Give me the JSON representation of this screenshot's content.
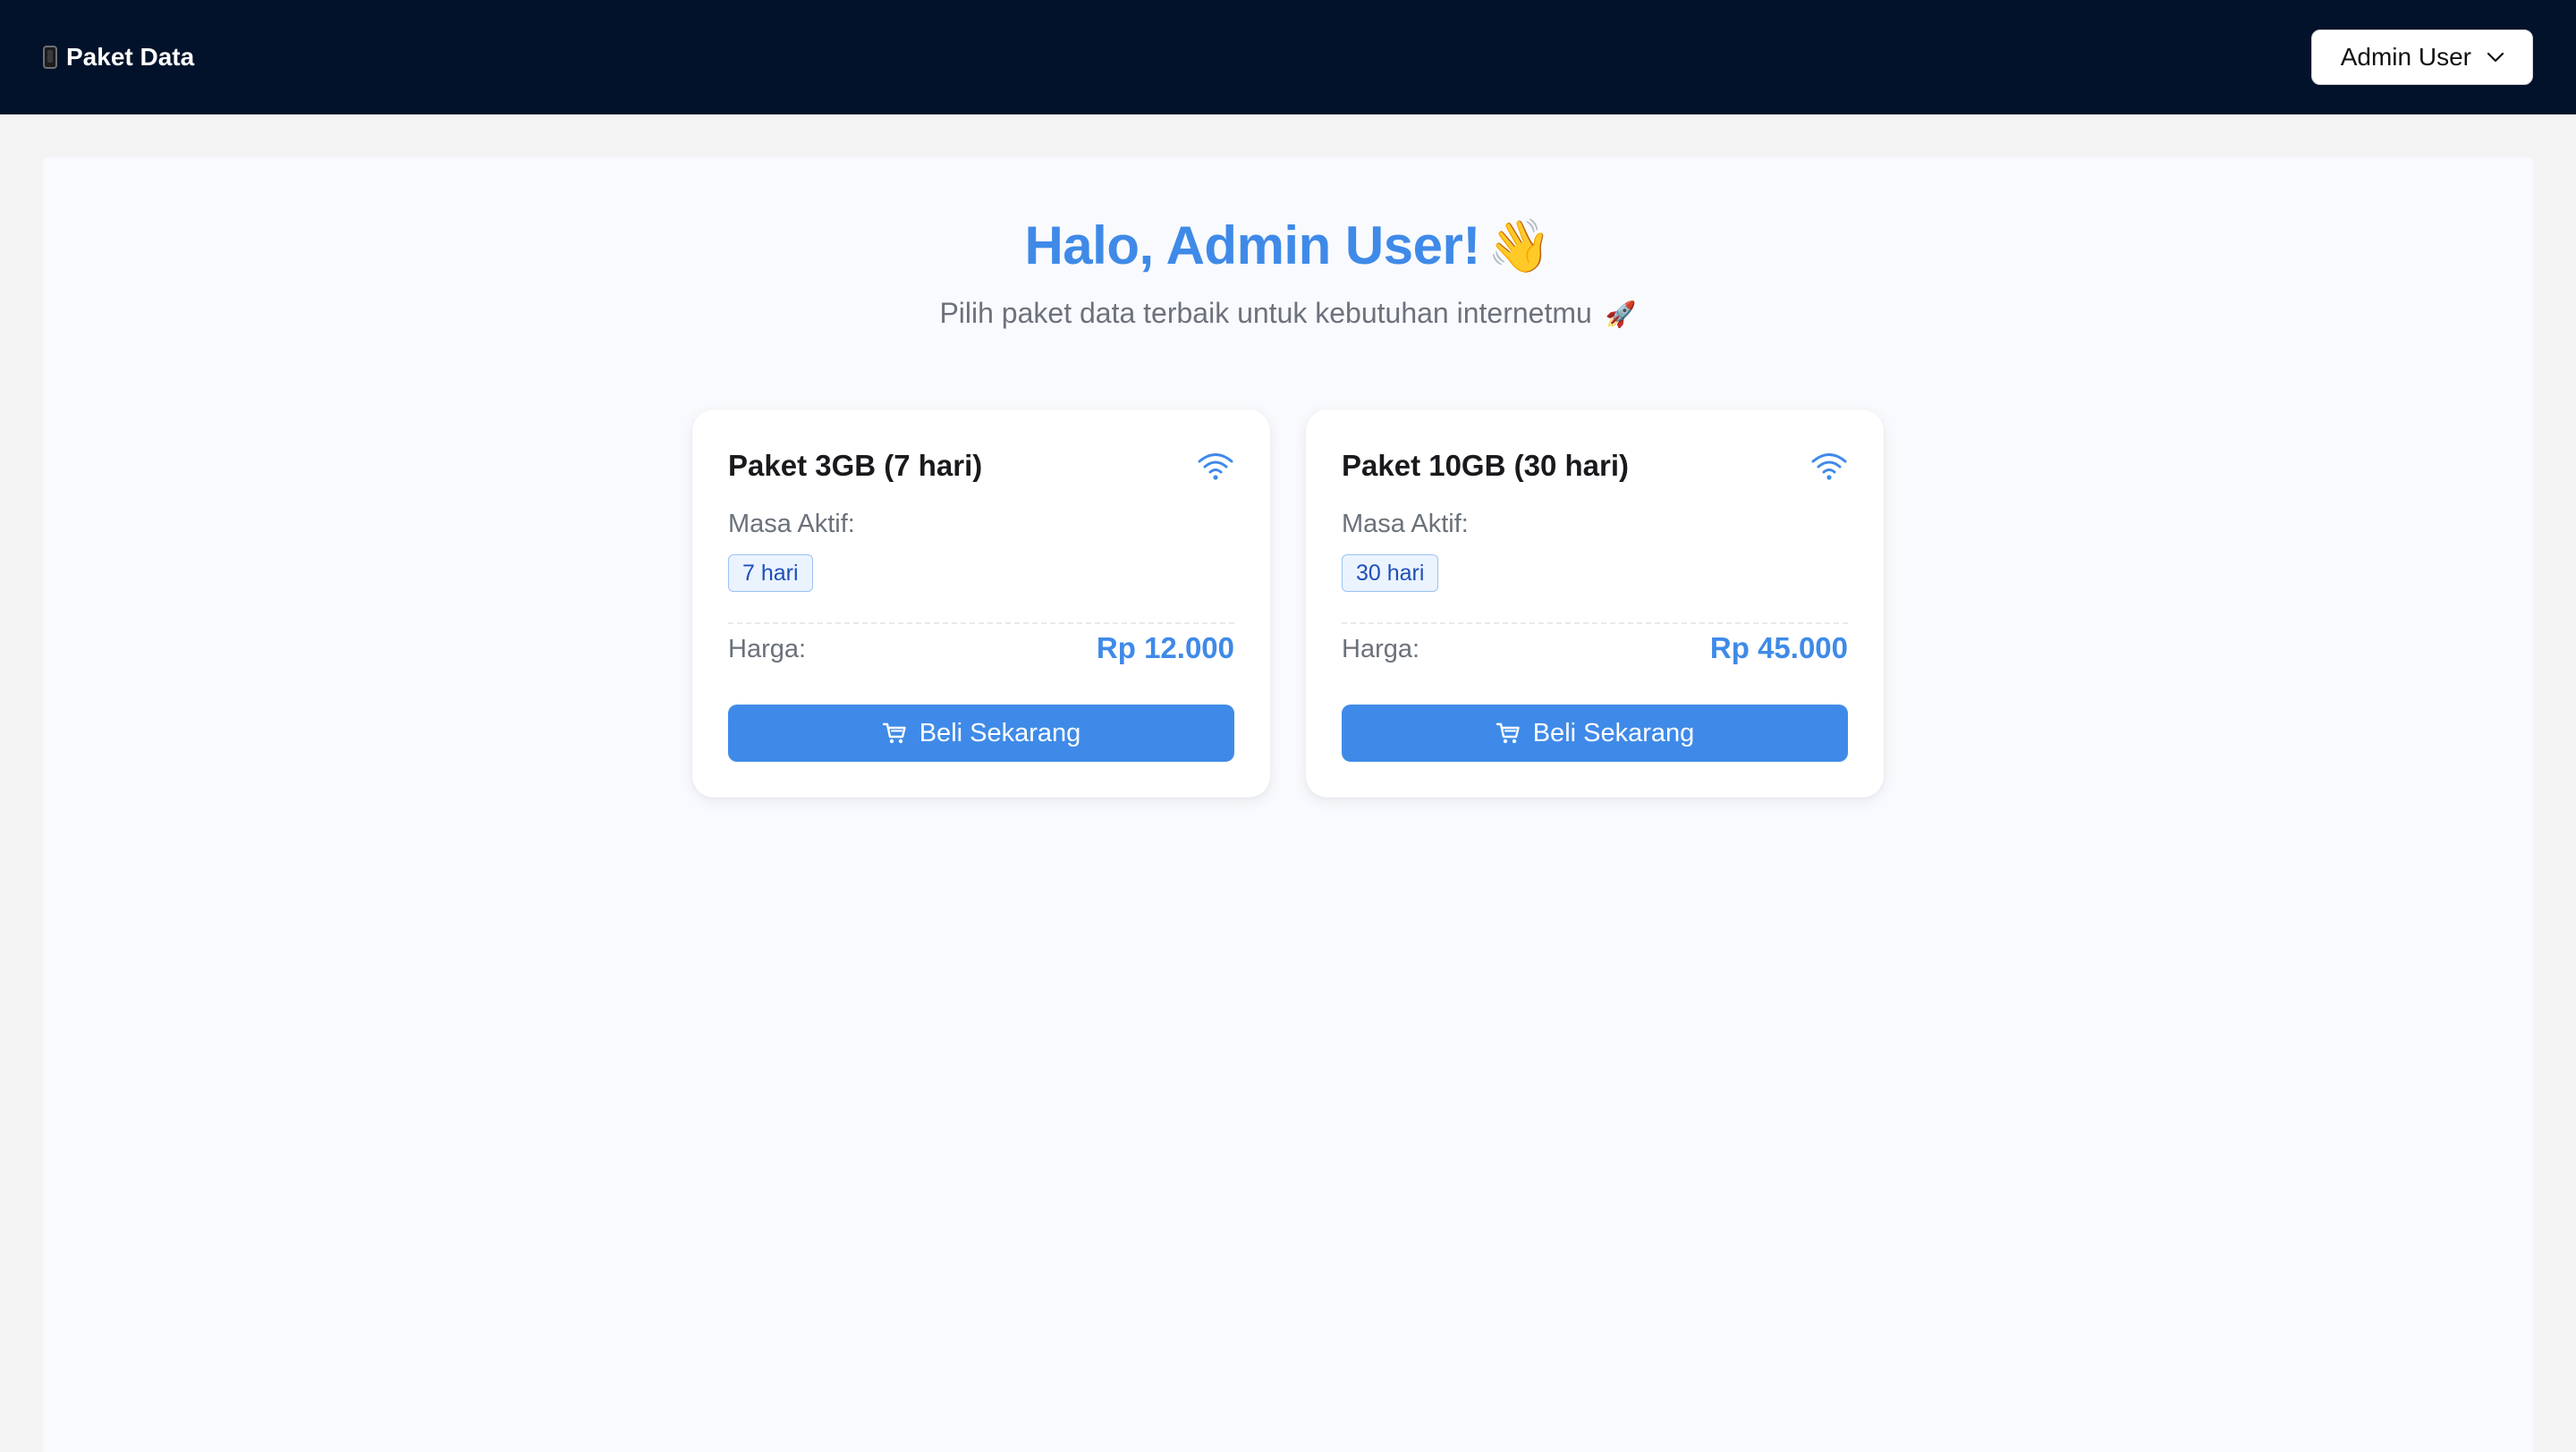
{
  "navbar": {
    "brand_icon": "mobile-phone-icon",
    "brand_label": "Paket Data",
    "user_label": "Admin User",
    "user_chevron_icon": "chevron-down-icon",
    "background_color": "#02122a"
  },
  "hero": {
    "title": "Halo, Admin User!",
    "title_emoji": "👋",
    "title_icon": "waving-hand-icon",
    "subtitle": "Pilih paket data terbaik untuk kebutuhan internetmu",
    "subtitle_emoji": "🚀",
    "subtitle_icon": "rocket-icon",
    "accent_color": "#3f8ae8"
  },
  "packages": [
    {
      "name": "Paket 3GB (7 hari)",
      "icon": "wifi-icon",
      "active_label": "Masa Aktif:",
      "active_period": "7 hari",
      "price_label": "Harga:",
      "price": "Rp 12.000",
      "buy_label": "Beli Sekarang",
      "buy_icon": "cart-icon"
    },
    {
      "name": "Paket 10GB (30 hari)",
      "icon": "wifi-icon",
      "active_label": "Masa Aktif:",
      "active_period": "30 hari",
      "price_label": "Harga:",
      "price": "Rp 45.000",
      "buy_label": "Beli Sekarang",
      "buy_icon": "cart-icon"
    }
  ]
}
